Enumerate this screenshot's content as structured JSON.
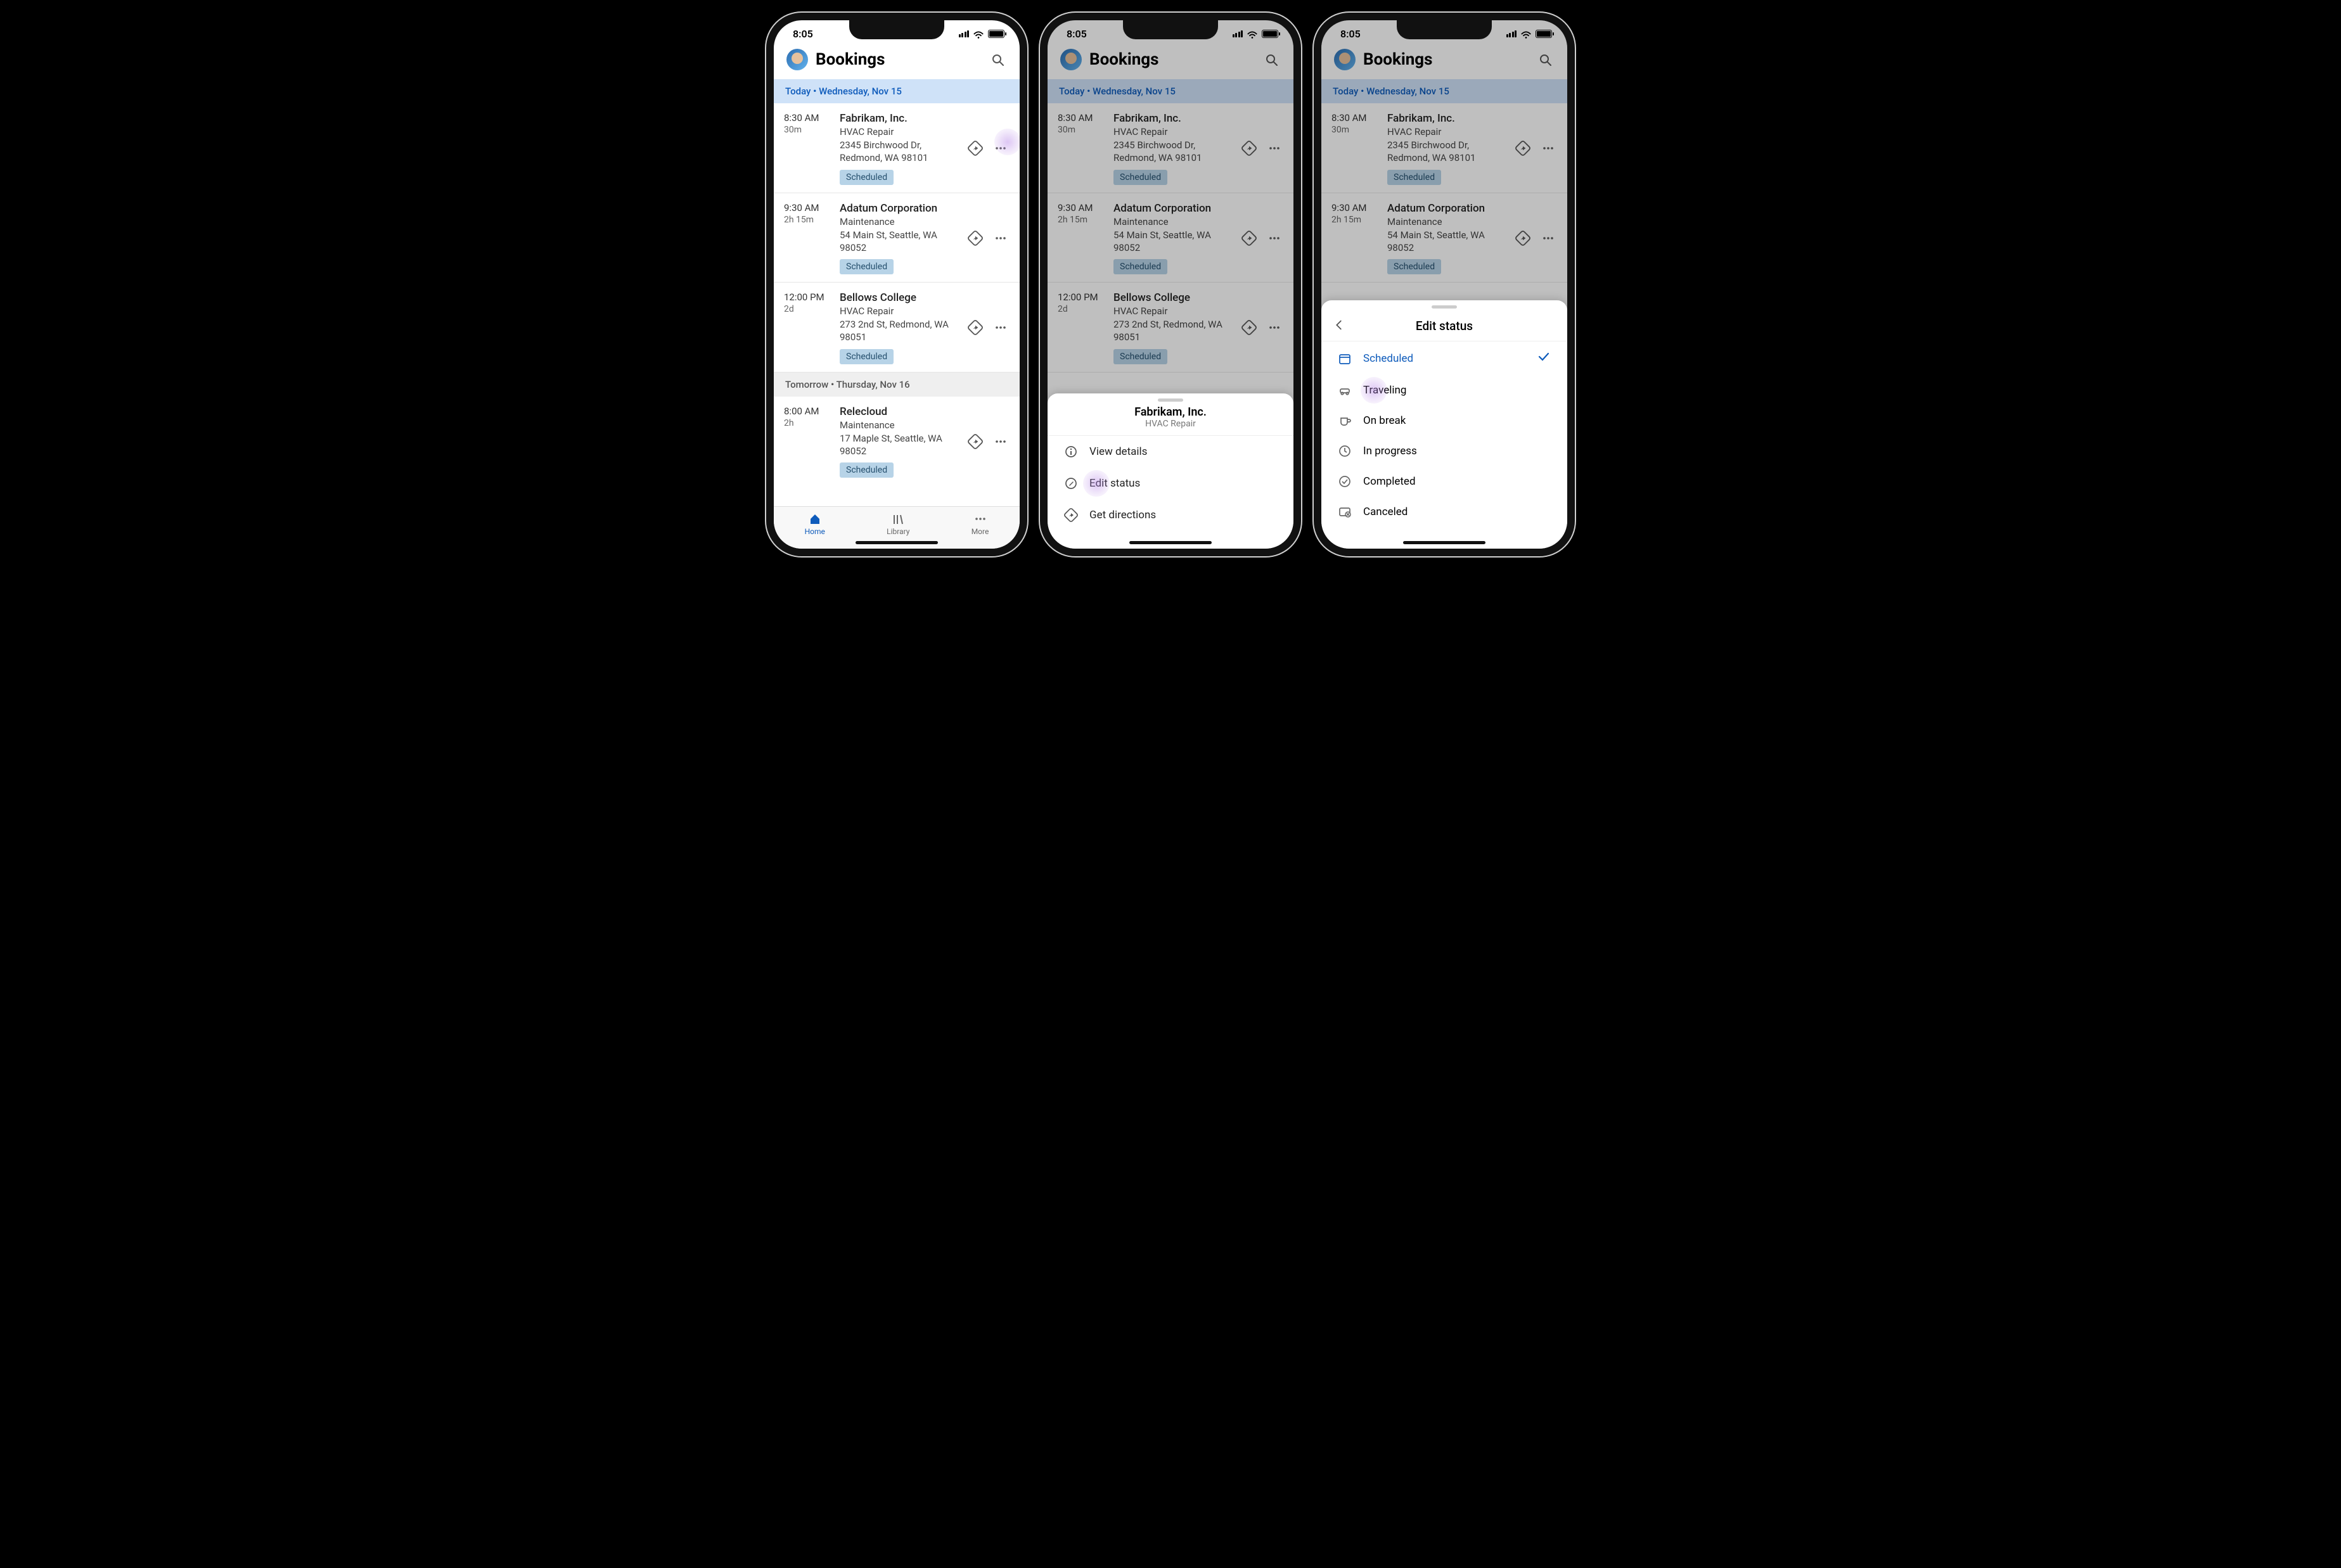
{
  "status_bar": {
    "time": "8:05"
  },
  "header": {
    "title": "Bookings"
  },
  "sections": {
    "today": {
      "prefix": "Today",
      "dot": "•",
      "date": "Wednesday, Nov 15"
    },
    "tomorrow": {
      "prefix": "Tomorrow",
      "dot": "•",
      "date": "Thursday, Nov 16"
    }
  },
  "bookings": [
    {
      "time": "8:30 AM",
      "duration": "30m",
      "customer": "Fabrikam, Inc.",
      "service": "HVAC Repair",
      "address": "2345 Birchwood Dr, Redmond, WA 98101",
      "status": "Scheduled"
    },
    {
      "time": "9:30 AM",
      "duration": "2h 15m",
      "customer": "Adatum Corporation",
      "service": "Maintenance",
      "address": "54 Main St, Seattle, WA 98052",
      "status": "Scheduled"
    },
    {
      "time": "12:00 PM",
      "duration": "2d",
      "customer": "Bellows College",
      "service": "HVAC Repair",
      "address": "273 2nd St, Redmond, WA 98051",
      "status": "Scheduled"
    },
    {
      "time": "8:00 AM",
      "duration": "2h",
      "customer": "Relecloud",
      "service": "Maintenance",
      "address": "17 Maple St, Seattle, WA 98052",
      "status": "Scheduled"
    }
  ],
  "tabs": {
    "home": "Home",
    "library": "Library",
    "more": "More"
  },
  "action_sheet": {
    "title": "Fabrikam, Inc.",
    "subtitle": "HVAC Repair",
    "items": {
      "view": "View details",
      "edit_status": "Edit status",
      "directions": "Get directions"
    }
  },
  "edit_status": {
    "title": "Edit status",
    "options": {
      "scheduled": "Scheduled",
      "traveling": "Traveling",
      "on_break": "On break",
      "in_progress": "In progress",
      "completed": "Completed",
      "canceled": "Canceled"
    }
  }
}
